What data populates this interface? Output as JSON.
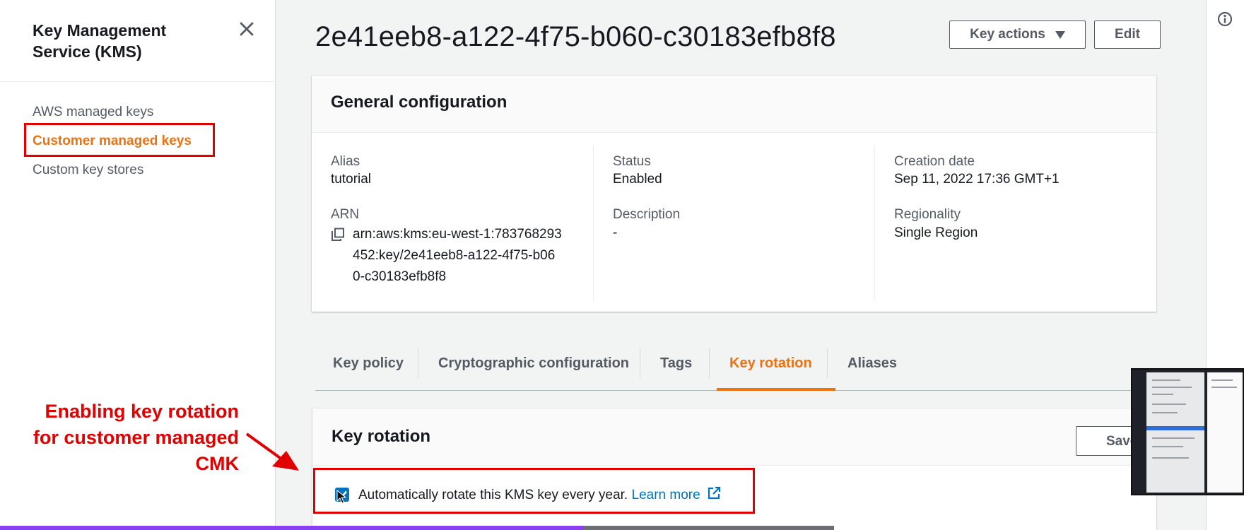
{
  "sidebar": {
    "title": "Key Management Service (KMS)",
    "items": [
      {
        "label": "AWS managed keys",
        "active": false
      },
      {
        "label": "Customer managed keys",
        "active": true
      },
      {
        "label": "Custom key stores",
        "active": false
      }
    ]
  },
  "annotation": {
    "lines": [
      "Enabling key rotation",
      "for customer managed",
      "CMK"
    ]
  },
  "header": {
    "key_id": "2e41eeb8-a122-4f75-b060-c30183efb8f8",
    "key_actions_label": "Key actions",
    "edit_label": "Edit"
  },
  "general_config": {
    "title": "General configuration",
    "alias_label": "Alias",
    "alias_value": "tutorial",
    "arn_label": "ARN",
    "arn_lines": [
      "arn:aws:kms:eu-west-1:783768293",
      "452:key/2e41eeb8-a122-4f75-b06",
      "0-c30183efb8f8"
    ],
    "status_label": "Status",
    "status_value": "Enabled",
    "description_label": "Description",
    "description_value": "-",
    "creation_label": "Creation date",
    "creation_value": "Sep 11, 2022 17:36 GMT+1",
    "regionality_label": "Regionality",
    "regionality_value": "Single Region"
  },
  "tabs": [
    {
      "label": "Key policy",
      "active": false
    },
    {
      "label": "Cryptographic configuration",
      "active": false
    },
    {
      "label": "Tags",
      "active": false
    },
    {
      "label": "Key rotation",
      "active": true
    },
    {
      "label": "Aliases",
      "active": false
    }
  ],
  "key_rotation": {
    "title": "Key rotation",
    "save_label": "Save",
    "checkbox_checked": true,
    "checkbox_label": "Automatically rotate this KMS key every year.",
    "learn_more": "Learn more"
  },
  "colors": {
    "accent": "#ec7211",
    "link": "#0073bb",
    "highlight": "#e00000"
  },
  "icons": [
    "close-icon",
    "caret-down-icon",
    "copy-icon",
    "external-link-icon",
    "info-icon",
    "cursor-icon"
  ],
  "progress": {
    "fraction": 0.7
  }
}
